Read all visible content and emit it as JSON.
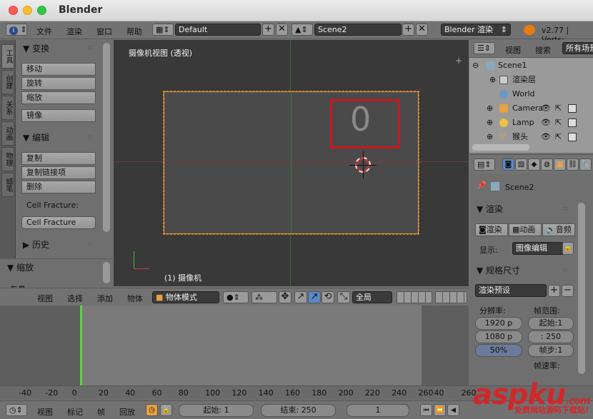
{
  "window": {
    "title": "Blender"
  },
  "main_header": {
    "menus": [
      "文件",
      "渲染",
      "窗口",
      "帮助"
    ],
    "screen_layout": "Default",
    "scene": "Scene2",
    "render_engine": "Blender 渲染",
    "version": "v2.77 | Verts:"
  },
  "tool_shelf": {
    "tabs": [
      "工具",
      "创建",
      "关系",
      "动画",
      "物理",
      "蜡笔"
    ],
    "transform_panel": "变换",
    "transform_buttons": [
      "移动",
      "旋转",
      "缩放"
    ],
    "mirror_button": "镜像",
    "edit_panel": "编辑",
    "edit_buttons": [
      "复制",
      "复制链接项",
      "删除"
    ],
    "cell_fracture_label": "Cell Fracture:",
    "cell_fracture_button": "Cell Fracture",
    "history_panel": "历史",
    "zoom_panel": "缩放",
    "partial_label": "矢量"
  },
  "viewport": {
    "title": "摄像机视图 (透视)",
    "object_label": "(1) 摄像机",
    "overlay_digit": "0",
    "header": {
      "menus": [
        "视图",
        "选择",
        "添加",
        "物体"
      ],
      "mode": "物体模式",
      "pivot": "全局"
    }
  },
  "outliner": {
    "header_menus": [
      "视图",
      "搜索"
    ],
    "filter": "所有场景",
    "rows": [
      {
        "label": "Scene1",
        "indent": 0
      },
      {
        "label": "渲染层",
        "indent": 1
      },
      {
        "label": "World",
        "indent": 1
      },
      {
        "label": "Camera",
        "indent": 1
      },
      {
        "label": "Lamp",
        "indent": 1
      },
      {
        "label": "猴头",
        "indent": 1
      }
    ]
  },
  "properties": {
    "scene_name": "Scene2",
    "render_panel": "渲染",
    "render_buttons": [
      "渲染",
      "动画",
      "音频"
    ],
    "display_label": "显示:",
    "display_value": "图像编辑",
    "dimensions_panel": "规格尺寸",
    "render_preset": "渲染预设",
    "resolution_label": "分辨率:",
    "res_x": "1920 p",
    "res_y": "1080 p",
    "res_percent": "50%",
    "frame_range_label": "帧范围:",
    "frame_start": "起始:1",
    "frame_end": ": 250",
    "frame_step": "帧步:1",
    "partial_label": "帧速率:"
  },
  "timeline": {
    "ticks": [
      "-40",
      "-20",
      "0",
      "20",
      "40",
      "60",
      "80",
      "100",
      "120",
      "140",
      "160",
      "180",
      "200",
      "220",
      "240",
      "260",
      "40",
      "260"
    ],
    "header_menus": [
      "视图",
      "标记",
      "帧",
      "回放"
    ],
    "start_label": "起始:",
    "start_value": "1",
    "end_label": "结束:",
    "end_value": "250",
    "current_frame": "1"
  },
  "watermark": {
    "brand": "aspku",
    "tld": ".com",
    "tagline": "免费网站源码下载站!"
  },
  "colors": {
    "accent_red": "#d0141c",
    "camera_border": "#e8a040",
    "current_frame": "#5fd04a"
  }
}
